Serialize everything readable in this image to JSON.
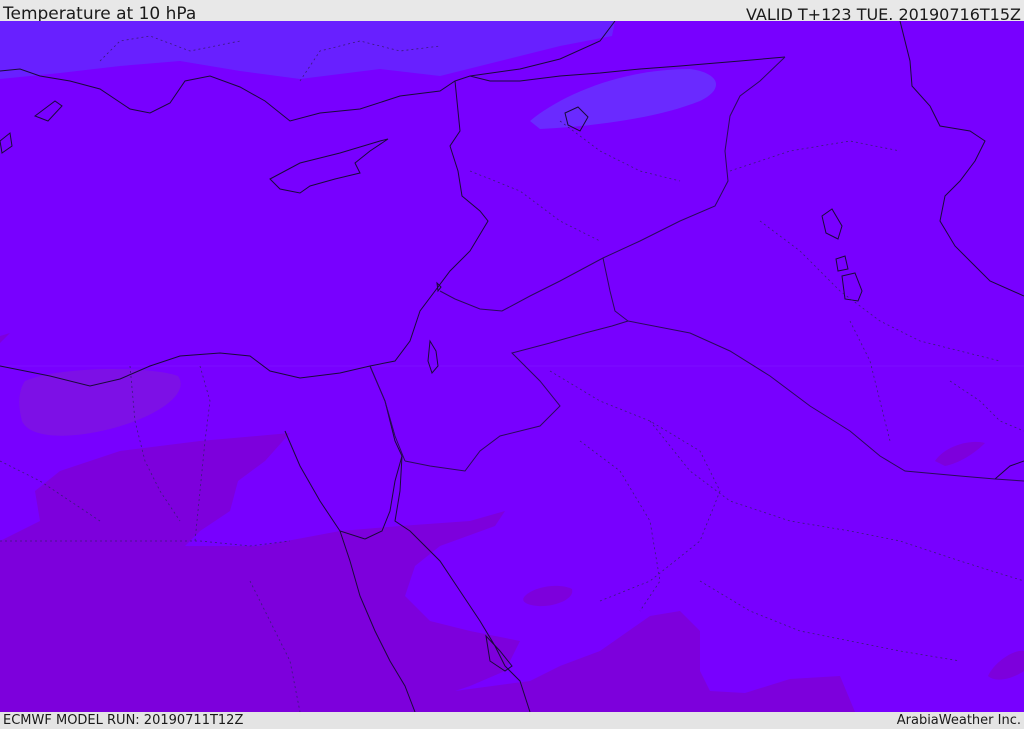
{
  "header": {
    "title": "Temperature at 10 hPa",
    "valid": "VALID T+123 TUE. 20190716T15Z"
  },
  "footer": {
    "model_run": "ECMWF MODEL RUN: 20190711T12Z",
    "credit": "ArabiaWeather Inc."
  },
  "colors": {
    "field_base": "#7800ff",
    "field_cold": "#6a1cff",
    "field_warm": "#7d00dc",
    "coastline": "#1a0a3a",
    "border": "#2a0a5a"
  },
  "map": {
    "variable": "Temperature",
    "level": "10 hPa"
  }
}
